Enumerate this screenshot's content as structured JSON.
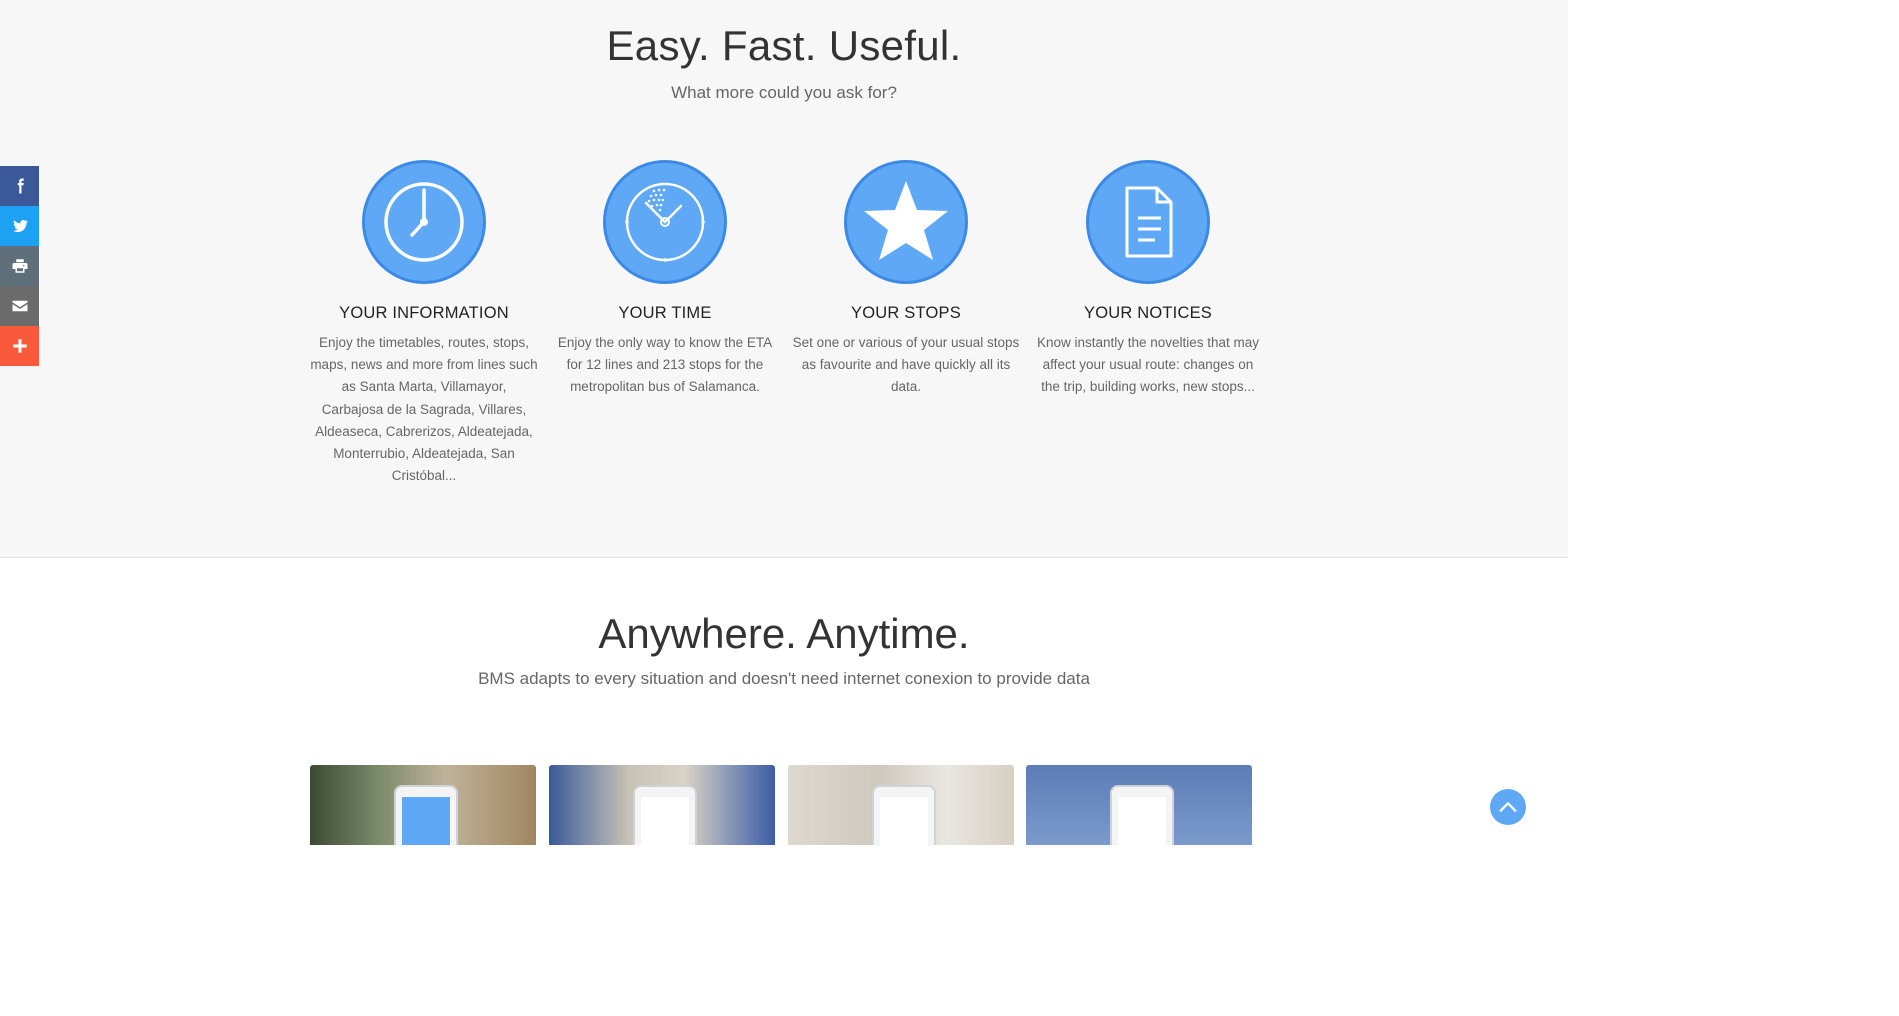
{
  "features_section": {
    "title": "Easy. Fast. Useful.",
    "subtitle": "What more could you ask for?",
    "items": [
      {
        "icon": "clock-icon",
        "heading": "YOUR INFORMATION",
        "text": "Enjoy the timetables, routes, stops, maps, news and more from lines such as Santa Marta, Villamayor, Carbajosa de la Sagrada, Villares, Aldeaseca, Cabrerizos, Aldeatejada, Monterrubio, Aldeatejada, San Cristóbal..."
      },
      {
        "icon": "stopwatch-icon",
        "heading": "YOUR TIME",
        "text": "Enjoy the only way to know the ETA for 12 lines and 213 stops for the metropolitan bus of Salamanca."
      },
      {
        "icon": "star-icon",
        "heading": "YOUR STOPS",
        "text": "Set one or various of your usual stops as favourite and have quickly all its data."
      },
      {
        "icon": "document-icon",
        "heading": "YOUR NOTICES",
        "text": "Know instantly the novelties that may affect your usual route: changes on the trip, building works, new stops..."
      }
    ]
  },
  "anywhere_section": {
    "title": "Anywhere. Anytime.",
    "subtitle": "BMS adapts to every situation and doesn't need internet conexion to provide data"
  },
  "social_bar": [
    {
      "name": "facebook",
      "icon": "facebook-icon",
      "color": "#3b5998"
    },
    {
      "name": "twitter",
      "icon": "twitter-icon",
      "color": "#1da1f2"
    },
    {
      "name": "print",
      "icon": "printer-icon",
      "color": "#5e6f7a"
    },
    {
      "name": "email",
      "icon": "envelope-icon",
      "color": "#6b6b6b"
    },
    {
      "name": "share",
      "icon": "plus-icon",
      "color": "#fa5a3c"
    }
  ],
  "colors": {
    "accent": "#5fa8f6",
    "accent_border": "#3d8ae6",
    "section_bg": "#f7f7f7"
  }
}
